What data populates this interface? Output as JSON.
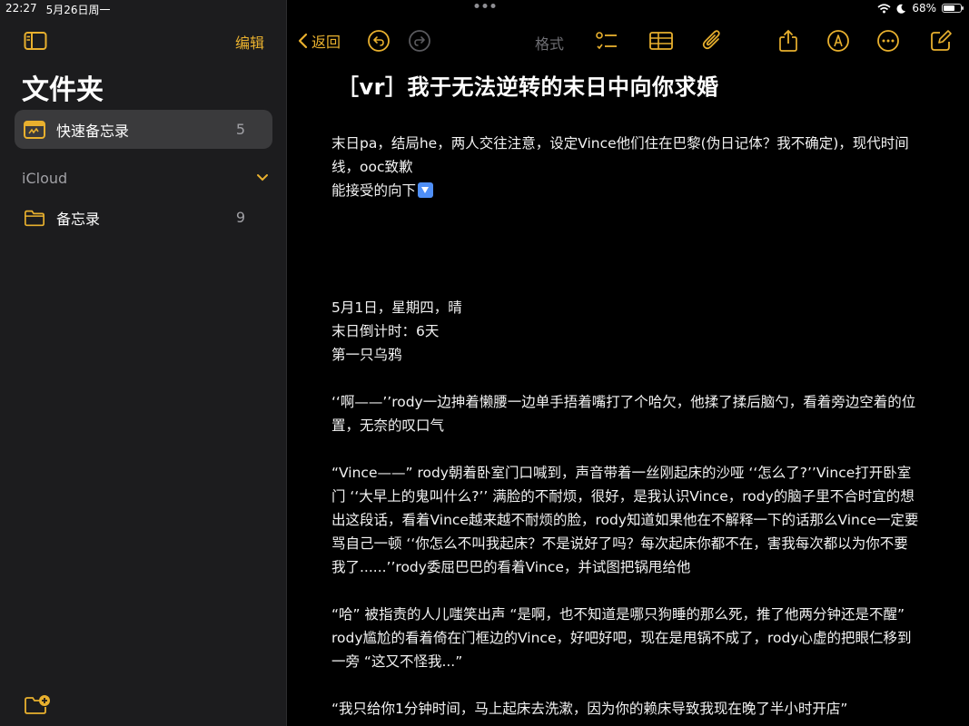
{
  "status": {
    "time": "22:27",
    "date": "5月26日周一",
    "battery": "68%",
    "battery_level": 0.68
  },
  "sidebar": {
    "edit_label": "编辑",
    "title": "文件夹",
    "quick_notes": {
      "label": "快速备忘录",
      "count": "5"
    },
    "icloud_label": "iCloud",
    "notes_folder": {
      "label": "备忘录",
      "count": "9"
    }
  },
  "toolbar": {
    "back_label": "返回",
    "format_label": "格式"
  },
  "colors": {
    "accent": "#e8b02e",
    "sidebar_bg": "#1c1c1e",
    "selected_bg": "#3a3a3c"
  },
  "note": {
    "title": "［vr］我于无法逆转的末日中向你求婚",
    "intro_1": "末日pa，结局he，两人交往注意，设定Vince他们住在巴黎(伪日记体？我不确定)，现代时间线，ooc致歉",
    "intro_2": "能接受的向下",
    "date_line": "5月1日，星期四，晴",
    "countdown": "末日倒计时：6天",
    "chapter": "第一只乌鸦",
    "p1": "‘‘啊——’’rody一边抻着懒腰一边单手捂着嘴打了个哈欠，他揉了揉后脑勺，看着旁边空着的位置，无奈的叹口气",
    "p2": "“Vince——” rody朝着卧室门口喊到，声音带着一丝刚起床的沙哑 ‘‘怎么了?’’Vince打开卧室门 ‘‘大早上的鬼叫什么?’’ 满脸的不耐烦，很好，是我认识Vince，rody的脑子里不合时宜的想出这段话，看着Vince越来越不耐烦的脸，rody知道如果他在不解释一下的话那么Vince一定要骂自己一顿 ‘‘你怎么不叫我起床？不是说好了吗？每次起床你都不在，害我每次都以为你不要我了......’’rody委屈巴巴的看着Vince，并试图把锅甩给他",
    "p3": "“哈” 被指责的人儿嗤笑出声 “是啊，也不知道是哪只狗睡的那么死，推了他两分钟还是不醒” rody尴尬的看着倚在门框边的Vince，好吧好吧，现在是甩锅不成了，rody心虚的把眼仁移到一旁 “这又不怪我...”",
    "p4": "“我只给你1分钟时间，马上起床去洗漱，因为你的赖床导致我现在晚了半小时开店”"
  }
}
